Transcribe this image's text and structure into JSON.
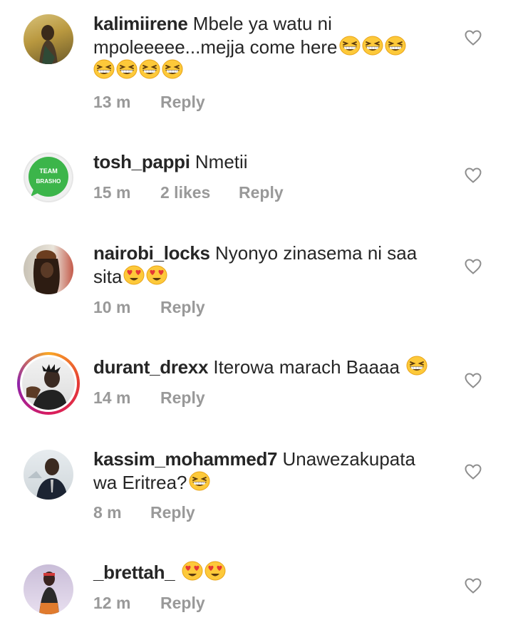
{
  "comments": [
    {
      "username": "kalimiirene",
      "text_line1": "Mbele ya watu ni",
      "text_line2": "mpoleeeee...mejja come here",
      "emojis_line2": [
        "grinning-squint-emoji",
        "grinning-squint-emoji",
        "grinning-squint-emoji"
      ],
      "emojis_line3": [
        "grinning-squint-emoji",
        "grinning-squint-emoji",
        "grinning-squint-emoji",
        "grinning-squint-emoji"
      ],
      "time": "13 m",
      "reply": "Reply"
    },
    {
      "username": "tosh_pappi",
      "text": "Nmetii",
      "avatar_text_top": "TEAM",
      "avatar_text_bottom": "BRASHO",
      "time": "15 m",
      "likes": "2 likes",
      "reply": "Reply"
    },
    {
      "username": "nairobi_locks",
      "text_line1": "Nyonyo zinasema ni saa",
      "text_line2": "sita",
      "emojis_line2": [
        "heart-eyes-emoji",
        "heart-eyes-emoji"
      ],
      "time": "10 m",
      "reply": "Reply"
    },
    {
      "username": "durant_drexx",
      "text": "Iterowa marach Baaaa",
      "emojis": [
        "grinning-squint-emoji"
      ],
      "time": "14 m",
      "reply": "Reply"
    },
    {
      "username": "kassim_mohammed7",
      "text_line1": "Unawezakupata",
      "text_line2": "wa Eritrea?",
      "emojis_line2": [
        "grinning-squint-emoji"
      ],
      "time": "8 m",
      "reply": "Reply"
    },
    {
      "username": "_brettah_",
      "emojis": [
        "heart-eyes-emoji",
        "heart-eyes-emoji"
      ],
      "time": "12 m",
      "reply": "Reply"
    }
  ],
  "colors": {
    "text": "#262626",
    "meta": "#999999",
    "story_ring_start": "#f9a825",
    "story_ring_end": "#8e24aa",
    "emoji_face": "#fdc93a"
  }
}
